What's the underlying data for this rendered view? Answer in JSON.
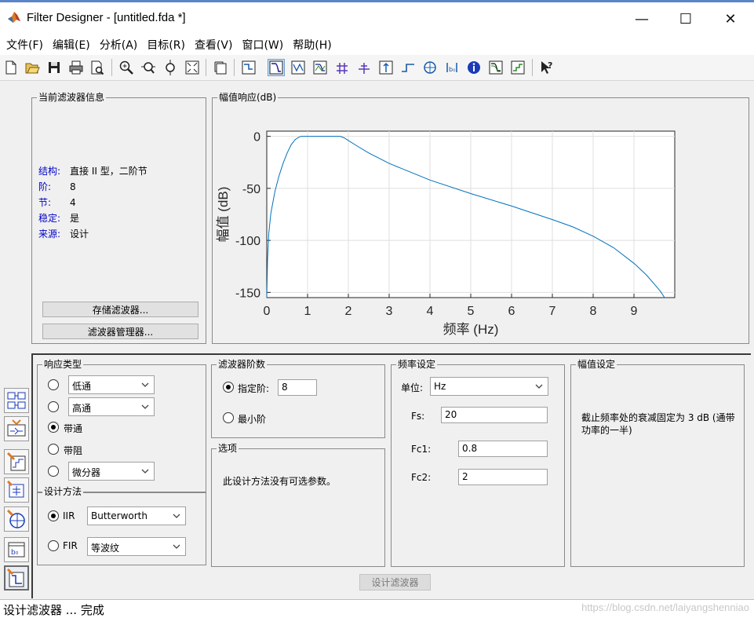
{
  "window": {
    "title": "Filter Designer -  [untitled.fda *]",
    "minimize": "—",
    "maximize": "☐",
    "close": "✕"
  },
  "menu": [
    "文件(F)",
    "编辑(E)",
    "分析(A)",
    "目标(R)",
    "查看(V)",
    "窗口(W)",
    "帮助(H)"
  ],
  "toolbar": {
    "buttons": [
      "new-icon",
      "open-icon",
      "save-icon",
      "print-icon",
      "print-preview-icon",
      "zoom-in-icon",
      "zoom-x-icon",
      "zoom-y-icon",
      "full-view-icon",
      "new-figure-icon",
      "filter-specs-icon",
      "magnitude-response-icon",
      "phase-response-icon",
      "magnitude-phase-icon",
      "group-delay-icon",
      "phase-delay-icon",
      "impulse-response-icon",
      "step-response-icon",
      "pole-zero-icon",
      "coefficients-icon",
      "info-icon",
      "cost-icon",
      "round-off-noise-icon",
      "whats-this-icon"
    ],
    "active": "magnitude-response-icon"
  },
  "current_filter": {
    "title": "当前滤波器信息",
    "rows": [
      {
        "key": "结构:",
        "value": "直接 II 型，二阶节"
      },
      {
        "key": "阶:",
        "value": "8"
      },
      {
        "key": "节:",
        "value": "4"
      },
      {
        "key": "稳定:",
        "value": "是"
      },
      {
        "key": "来源:",
        "value": "设计"
      }
    ],
    "store_button": "存储滤波器...",
    "manager_button": "滤波器管理器..."
  },
  "magnitude_panel": {
    "title": "幅值响应(dB)"
  },
  "chart_data": {
    "type": "line",
    "title": "",
    "xlabel": "频率 (Hz)",
    "ylabel": "幅值 (dB)",
    "xlim": [
      0,
      10
    ],
    "ylim": [
      -155,
      5
    ],
    "xticks": [
      "0",
      "1",
      "2",
      "3",
      "4",
      "5",
      "6",
      "7",
      "8",
      "9"
    ],
    "xtick_values": [
      0,
      1,
      2,
      3,
      4,
      5,
      6,
      7,
      8,
      9
    ],
    "yticks": [
      "0",
      "-50",
      "-100",
      "-150"
    ],
    "ytick_values": [
      0,
      -50,
      -100,
      -150
    ],
    "grid": true,
    "color": "#0072bd",
    "series": [
      {
        "x": [
          0.0,
          0.02,
          0.05,
          0.1,
          0.2,
          0.3,
          0.4,
          0.5,
          0.6,
          0.7,
          0.8,
          0.85,
          0.9,
          1.0,
          1.5,
          1.8,
          1.9,
          2.0,
          2.2,
          2.5,
          3.0,
          3.5,
          4.0,
          5.0,
          6.0,
          7.0,
          7.5,
          8.0,
          8.5,
          9.0,
          9.3,
          9.5,
          9.65,
          9.75
        ],
        "y": [
          -155,
          -118,
          -93,
          -74,
          -53,
          -38,
          -26,
          -16,
          -8,
          -3,
          -0.5,
          0,
          0,
          0,
          0,
          0,
          -1.5,
          -4,
          -9,
          -16,
          -26,
          -34,
          -42,
          -55,
          -67,
          -80,
          -87,
          -96,
          -107,
          -122,
          -133,
          -142,
          -149,
          -155
        ]
      }
    ]
  },
  "response_type": {
    "title": "响应类型",
    "options": [
      {
        "label": "低通",
        "kind": "select",
        "value": "低通",
        "selected": false
      },
      {
        "label": "高通",
        "kind": "select",
        "value": "高通",
        "selected": false
      },
      {
        "label": "带通",
        "kind": "text",
        "selected": true
      },
      {
        "label": "带阻",
        "kind": "text",
        "selected": false
      },
      {
        "label": "微分器",
        "kind": "select",
        "value": "微分器",
        "selected": false
      }
    ]
  },
  "design_method": {
    "title": "设计方法",
    "iir_label": "IIR",
    "iir_value": "Butterworth",
    "iir_selected": true,
    "fir_label": "FIR",
    "fir_value": "等波纹",
    "fir_selected": false
  },
  "filter_order": {
    "title": "滤波器阶数",
    "specify_label": "指定阶:",
    "specify_value": "8",
    "specify_selected": true,
    "minimum_label": "最小阶",
    "minimum_selected": false
  },
  "options": {
    "title": "选项",
    "text": "此设计方法没有可选参数。"
  },
  "freq_spec": {
    "title": "频率设定",
    "units_label": "单位:",
    "units_value": "Hz",
    "fs_label": "Fs:",
    "fs_value": "20",
    "fc1_label": "Fc1:",
    "fc1_value": "0.8",
    "fc2_label": "Fc2:",
    "fc2_value": "2"
  },
  "mag_spec": {
    "title": "幅值设定",
    "text": "截止频率处的衰减固定为 3 dB (通带功率的一半)"
  },
  "design_button": "设计滤波器",
  "side_buttons": [
    "transform-filter-icon",
    "realize-model-icon",
    "pole-zero-editor-icon",
    "multirate-icon",
    "quantize-icon",
    "import-filter-icon",
    "design-filter-icon"
  ],
  "status": "设计滤波器 ... 完成",
  "watermark": "https://blog.csdn.net/laiyangshenniao"
}
